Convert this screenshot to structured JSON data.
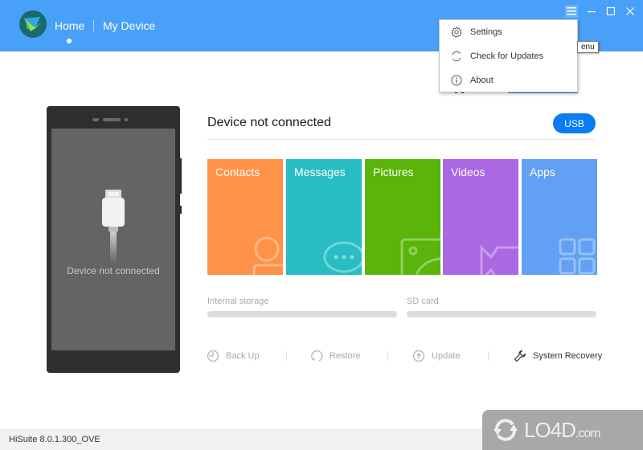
{
  "header": {
    "nav": [
      {
        "label": "Home",
        "active": true
      },
      {
        "label": "My Device",
        "active": false
      }
    ],
    "window_controls": [
      "menu-icon",
      "minimize-icon",
      "maximize-icon",
      "close-icon"
    ],
    "bg_color": "#48a0f8"
  },
  "dropdown_menu": {
    "items": [
      {
        "label": "Settings",
        "icon": "gear-icon"
      },
      {
        "label": "Check for Updates",
        "icon": "refresh-icon"
      },
      {
        "label": "About",
        "icon": "info-icon"
      }
    ],
    "tooltip": "enu"
  },
  "phone": {
    "status_text": "Device not connected"
  },
  "device_status": {
    "title": "Device not connected",
    "connection_button": "USB"
  },
  "tiles": [
    {
      "label": "Contacts",
      "color": "#ff9248",
      "icon": "contact-icon"
    },
    {
      "label": "Messages",
      "color": "#27bdc3",
      "icon": "chat-icon"
    },
    {
      "label": "Pictures",
      "color": "#5ab40a",
      "icon": "picture-icon"
    },
    {
      "label": "Videos",
      "color": "#aa68e2",
      "icon": "video-icon"
    },
    {
      "label": "Apps",
      "color": "#62a0f4",
      "icon": "apps-icon"
    }
  ],
  "storage": [
    {
      "label": "Internal storage",
      "used_percent": 0
    },
    {
      "label": "SD card",
      "used_percent": 0
    }
  ],
  "actions": [
    {
      "label": "Back Up",
      "icon": "backup-icon",
      "enabled": false
    },
    {
      "label": "Restore",
      "icon": "restore-icon",
      "enabled": false
    },
    {
      "label": "Update",
      "icon": "update-icon",
      "enabled": false
    },
    {
      "label": "System Recovery",
      "icon": "wrench-icon",
      "enabled": true
    }
  ],
  "footer": {
    "version": "HiSuite 8.0.1.300_OVE"
  },
  "watermark": {
    "text": "LO4D",
    "suffix": ".com"
  }
}
